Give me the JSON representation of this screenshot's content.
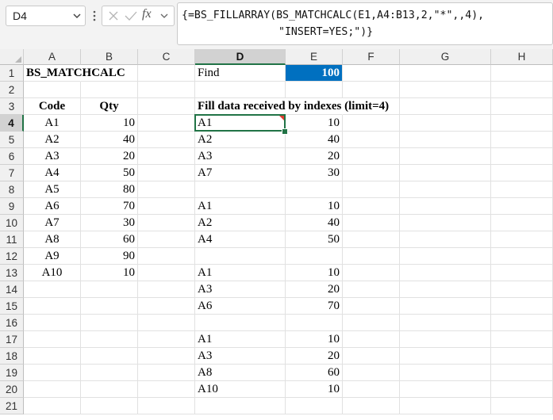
{
  "formula_bar": {
    "name_box": "D4",
    "fx_label": "fx",
    "formula_line1": "{=BS_FILLARRAY(BS_MATCHCALC(E1,A4:B13,2,\"*\",,4),",
    "formula_line2": "\"INSERT=YES;\")}"
  },
  "columns": [
    "A",
    "B",
    "C",
    "D",
    "E",
    "F",
    "G",
    "H"
  ],
  "selected_column": "D",
  "selected_row": "4",
  "rows": [
    {
      "num": "1",
      "A": "BS_MATCHCALC",
      "B": "",
      "C": "",
      "D": "Find",
      "E": "100"
    },
    {
      "num": "2",
      "A": "",
      "B": "",
      "C": "",
      "D": "",
      "E": ""
    },
    {
      "num": "3",
      "A": "Code",
      "B": "Qty",
      "C": "",
      "D": "Fill data received by indexes (limit=4)",
      "E": ""
    },
    {
      "num": "4",
      "A": "A1",
      "B": "10",
      "C": "",
      "D": "A1",
      "E": "10"
    },
    {
      "num": "5",
      "A": "A2",
      "B": "40",
      "C": "",
      "D": "A2",
      "E": "40"
    },
    {
      "num": "6",
      "A": "A3",
      "B": "20",
      "C": "",
      "D": "A3",
      "E": "20"
    },
    {
      "num": "7",
      "A": "A4",
      "B": "50",
      "C": "",
      "D": "A7",
      "E": "30"
    },
    {
      "num": "8",
      "A": "A5",
      "B": "80",
      "C": "",
      "D": "",
      "E": ""
    },
    {
      "num": "9",
      "A": "A6",
      "B": "70",
      "C": "",
      "D": "A1",
      "E": "10"
    },
    {
      "num": "10",
      "A": "A7",
      "B": "30",
      "C": "",
      "D": "A2",
      "E": "40"
    },
    {
      "num": "11",
      "A": "A8",
      "B": "60",
      "C": "",
      "D": "A4",
      "E": "50"
    },
    {
      "num": "12",
      "A": "A9",
      "B": "90",
      "C": "",
      "D": "",
      "E": ""
    },
    {
      "num": "13",
      "A": "A10",
      "B": "10",
      "C": "",
      "D": "A1",
      "E": "10"
    },
    {
      "num": "14",
      "A": "",
      "B": "",
      "C": "",
      "D": "A3",
      "E": "20"
    },
    {
      "num": "15",
      "A": "",
      "B": "",
      "C": "",
      "D": "A6",
      "E": "70"
    },
    {
      "num": "16",
      "A": "",
      "B": "",
      "C": "",
      "D": "",
      "E": ""
    },
    {
      "num": "17",
      "A": "",
      "B": "",
      "C": "",
      "D": "A1",
      "E": "10"
    },
    {
      "num": "18",
      "A": "",
      "B": "",
      "C": "",
      "D": "A3",
      "E": "20"
    },
    {
      "num": "19",
      "A": "",
      "B": "",
      "C": "",
      "D": "A8",
      "E": "60"
    },
    {
      "num": "20",
      "A": "",
      "B": "",
      "C": "",
      "D": "A10",
      "E": "10"
    },
    {
      "num": "21",
      "A": "",
      "B": "",
      "C": "",
      "D": "",
      "E": ""
    }
  ],
  "colors": {
    "highlight_fill": "#0070c0",
    "highlight_text": "#ffffff",
    "selection_green": "#217346",
    "comment_marker": "#e03c31"
  }
}
